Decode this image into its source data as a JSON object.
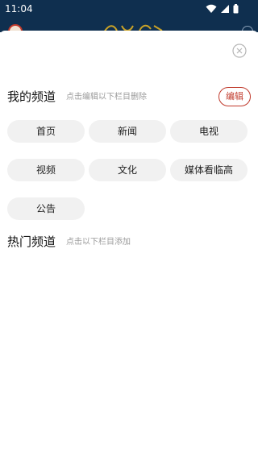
{
  "status_bar": {
    "time": "11:04",
    "icons": [
      "wifi-icon",
      "signal-icon",
      "battery-icon"
    ]
  },
  "colors": {
    "status_bar_bg": "#0f2f4f",
    "accent": "#c0392b",
    "chip_bg": "#f1f1f1",
    "hint_text": "#9a9a9a"
  },
  "channel_editor": {
    "my_channels": {
      "title": "我的频道",
      "hint": "点击编辑以下栏目删除",
      "edit_label": "编辑",
      "items": [
        "首页",
        "新闻",
        "电视",
        "视频",
        "文化",
        "媒体看临高",
        "公告"
      ]
    },
    "hot_channels": {
      "title": "热门频道",
      "hint": "点击以下栏目添加"
    }
  }
}
